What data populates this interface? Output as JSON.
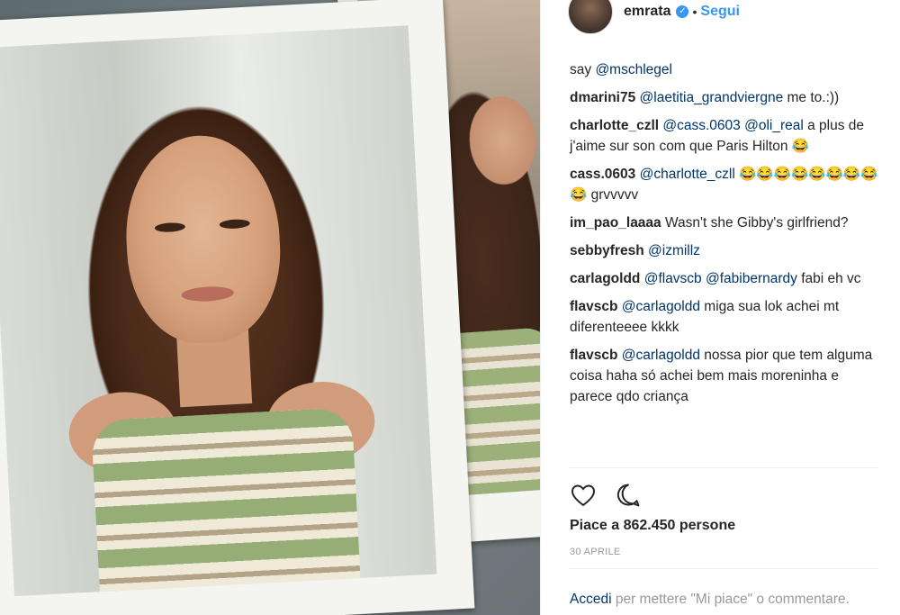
{
  "post": {
    "username": "emrata",
    "follow_separator": "•",
    "follow_label": "Segui",
    "likes_text": "Piace a 862.450 persone",
    "date": "30 APRILE",
    "login_link": "Accedi",
    "login_text": " per mettere \"Mi piace\" o commentare."
  },
  "icons": {
    "verified": "verified-badge-icon",
    "like": "heart-icon",
    "comment": "speech-bubble-icon"
  },
  "colors": {
    "link_blue": "#3897f0",
    "mention_blue": "#003569",
    "text": "#262626",
    "muted": "#999999"
  },
  "comments": [
    {
      "user": "",
      "mentions": [
        "@mschlegel"
      ],
      "text": "say",
      "mentions_first": false
    },
    {
      "user": "dmarini75",
      "mentions": [
        "@laetitia_grandviergne"
      ],
      "text": " me to.:))"
    },
    {
      "user": "charlotte_czll",
      "mentions": [
        "@cass.0603",
        "@oli_real"
      ],
      "text": " a plus de j'aime sur son com que Paris Hilton 😂"
    },
    {
      "user": "cass.0603",
      "mentions": [
        "@charlotte_czll"
      ],
      "text": " 😂😂😂😂😂😂😂😂😂 grvvvvv"
    },
    {
      "user": "im_pao_laaaa",
      "mentions": [],
      "text": "Wasn't she Gibby's girlfriend?"
    },
    {
      "user": "sebbyfresh",
      "mentions": [
        "@izmillz"
      ],
      "text": ""
    },
    {
      "user": "carlagoldd",
      "mentions": [
        "@flavscb",
        "@fabibernardy"
      ],
      "text": " fabi eh vc"
    },
    {
      "user": "flavscb",
      "mentions": [
        "@carlagoldd"
      ],
      "text": " miga sua lok achei mt diferenteeee kkkk"
    },
    {
      "user": "flavscb",
      "mentions": [
        "@carlagoldd"
      ],
      "text": " nossa pior que tem alguma coisa haha só achei bem mais moreninha e parece qdo criança"
    }
  ]
}
